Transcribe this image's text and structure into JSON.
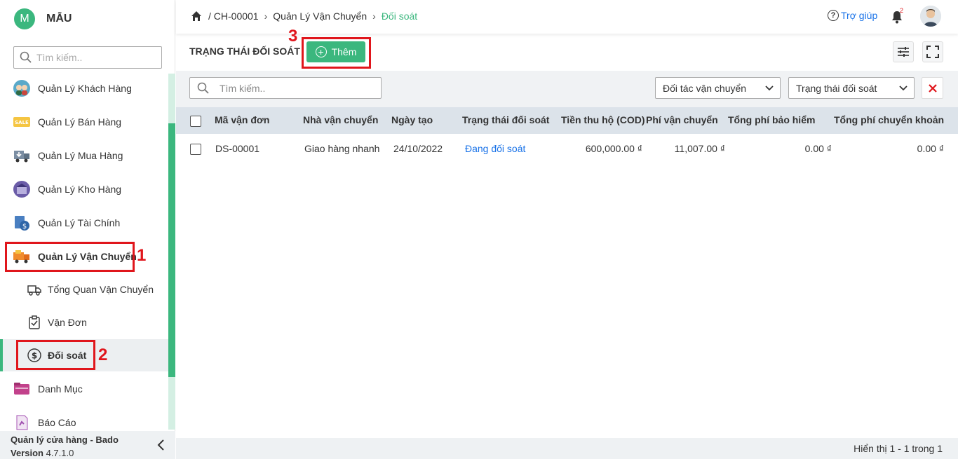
{
  "sidebar": {
    "brand_initial": "M",
    "brand_name": "MẪU",
    "search_placeholder": "Tìm kiếm..",
    "items": [
      {
        "label": "Quản Lý Khách Hàng",
        "icon": "customers-icon"
      },
      {
        "label": "Quản Lý Bán Hàng",
        "icon": "sale-tag-icon"
      },
      {
        "label": "Quản Lý Mua Hàng",
        "icon": "purchase-truck-icon"
      },
      {
        "label": "Quản Lý Kho Hàng",
        "icon": "warehouse-icon"
      },
      {
        "label": "Quản Lý Tài Chính",
        "icon": "finance-icon"
      },
      {
        "label": "Quản Lý Vận Chuyển",
        "icon": "shipping-truck-icon",
        "active": true
      },
      {
        "label": "Danh Mục",
        "icon": "folder-icon"
      },
      {
        "label": "Báo Cáo",
        "icon": "report-icon"
      }
    ],
    "sub_items": [
      {
        "label": "Tổng Quan Vận Chuyển",
        "icon": "delivery-truck-icon"
      },
      {
        "label": "Vận Đơn",
        "icon": "clipboard-check-icon"
      },
      {
        "label": "Đối soát",
        "icon": "dollar-circle-icon",
        "active": true
      }
    ],
    "footer_app": "Quản lý cửa hàng - Bado",
    "footer_version_label": "Version",
    "footer_version": "4.7.1.0"
  },
  "annotations": [
    "1",
    "2",
    "3"
  ],
  "topbar": {
    "breadcrumb": [
      "/ CH-00001",
      "Quản Lý Vận Chuyển",
      "Đối soát"
    ],
    "help_label": "Trợ giúp",
    "notification_count": "2"
  },
  "toolbar": {
    "title": "TRẠNG THÁI ĐỐI SOÁT",
    "add_label": "Thêm"
  },
  "filters": {
    "search_placeholder": "Tìm kiếm..",
    "partner_label": "Đối tác vận chuyển",
    "status_label": "Trạng thái đối soát"
  },
  "table": {
    "columns": [
      "Mã vận đơn",
      "Nhà vận chuyển",
      "Ngày tạo",
      "Trạng thái đối soát",
      "Tiền thu hộ (COD)",
      "Phí vận chuyển",
      "Tổng phí bảo hiểm",
      "Tổng phí chuyển khoản"
    ],
    "rows": [
      {
        "code": "DS-00001",
        "carrier": "Giao hàng nhanh",
        "date": "24/10/2022",
        "status": "Đang đối soát",
        "cod": "600,000.00 ₫",
        "shipping_fee": "11,007.00 ₫",
        "insurance_fee": "0.00 ₫",
        "transfer_fee": "0.00 ₫"
      }
    ]
  },
  "footer": {
    "pagination": "Hiển thị 1 - 1 trong 1"
  },
  "colors": {
    "accent": "#3bb77e",
    "annotation_red": "#e0161c",
    "link": "#1a73e8"
  }
}
